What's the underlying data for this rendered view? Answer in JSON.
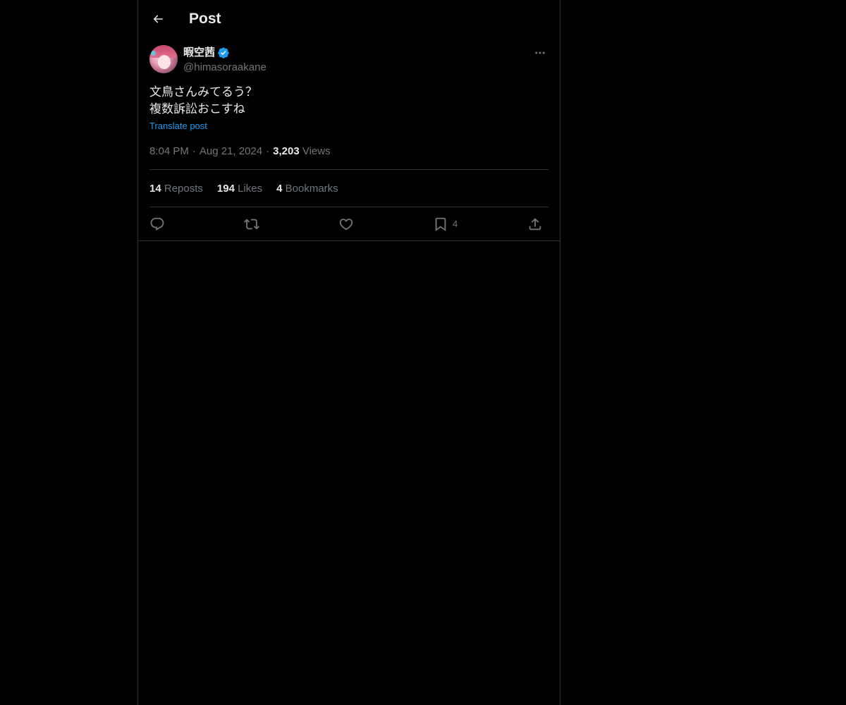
{
  "header": {
    "title": "Post"
  },
  "author": {
    "display_name": "暇空茜",
    "handle": "@himasoraakane",
    "verified": true
  },
  "post": {
    "text": "文鳥さんみてるう？\n複数訴訟おこすね",
    "translate_label": "Translate post",
    "time": "8:04 PM",
    "date": "Aug 21, 2024",
    "separator": "·",
    "views_count": "3,203",
    "views_label": "Views"
  },
  "stats": {
    "reposts_count": "14",
    "reposts_label": "Reposts",
    "likes_count": "194",
    "likes_label": "Likes",
    "bookmarks_count": "4",
    "bookmarks_label": "Bookmarks"
  },
  "actions": {
    "bookmark_count": "4"
  },
  "icons": {
    "back": "arrow-left-icon",
    "more": "more-horizontal-icon",
    "verified": "verified-badge-icon",
    "reply": "reply-icon",
    "repost": "repost-icon",
    "like": "heart-icon",
    "bookmark": "bookmark-icon",
    "share": "share-icon"
  },
  "colors": {
    "background": "#000000",
    "text_primary": "#e7e9ea",
    "text_secondary": "#71767b",
    "accent": "#1d9bf0",
    "border": "#2f3336"
  }
}
